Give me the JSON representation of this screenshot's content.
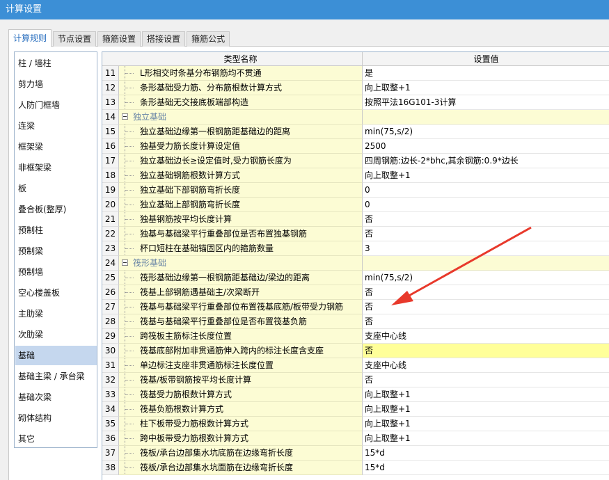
{
  "window": {
    "title": "计算设置"
  },
  "tabs": [
    {
      "label": "计算规则",
      "active": true
    },
    {
      "label": "节点设置",
      "active": false
    },
    {
      "label": "箍筋设置",
      "active": false
    },
    {
      "label": "搭接设置",
      "active": false
    },
    {
      "label": "箍筋公式",
      "active": false
    }
  ],
  "sidebar": {
    "items": [
      {
        "label": "柱 / 墙柱"
      },
      {
        "label": "剪力墙"
      },
      {
        "label": "人防门框墙"
      },
      {
        "label": "连梁"
      },
      {
        "label": "框架梁"
      },
      {
        "label": "非框架梁"
      },
      {
        "label": "板"
      },
      {
        "label": "叠合板(整厚)"
      },
      {
        "label": "预制柱"
      },
      {
        "label": "预制梁"
      },
      {
        "label": "预制墙"
      },
      {
        "label": "空心楼盖板"
      },
      {
        "label": "主肋梁"
      },
      {
        "label": "次肋梁"
      },
      {
        "label": "基础",
        "selected": true
      },
      {
        "label": "基础主梁 / 承台梁"
      },
      {
        "label": "基础次梁"
      },
      {
        "label": "砌体结构"
      },
      {
        "label": "其它"
      }
    ]
  },
  "table": {
    "headers": {
      "name": "类型名称",
      "value": "设置值"
    },
    "rows": [
      {
        "num": "11",
        "name": "L形相交时条基分布钢筋均不贯通",
        "value": "是"
      },
      {
        "num": "12",
        "name": "条形基础受力筋、分布筋根数计算方式",
        "value": "向上取整+1"
      },
      {
        "num": "13",
        "name": "条形基础无交接底板端部构造",
        "value": "按照平法16G101-3计算"
      },
      {
        "num": "14",
        "name": "独立基础",
        "value": "",
        "group": true
      },
      {
        "num": "15",
        "name": "独立基础边缘第一根钢筋距基础边的距离",
        "value": "min(75,s/2)"
      },
      {
        "num": "16",
        "name": "独基受力筋长度计算设定值",
        "value": "2500"
      },
      {
        "num": "17",
        "name": "独立基础边长≥设定值时,受力钢筋长度为",
        "value": "四周钢筋:边长-2*bhc,其余钢筋:0.9*边长"
      },
      {
        "num": "18",
        "name": "独立基础钢筋根数计算方式",
        "value": "向上取整+1"
      },
      {
        "num": "19",
        "name": "独立基础下部钢筋弯折长度",
        "value": "0"
      },
      {
        "num": "20",
        "name": "独立基础上部钢筋弯折长度",
        "value": "0"
      },
      {
        "num": "21",
        "name": "独基钢筋按平均长度计算",
        "value": "否"
      },
      {
        "num": "22",
        "name": "独基与基础梁平行重叠部位是否布置独基钢筋",
        "value": "否"
      },
      {
        "num": "23",
        "name": "杯口短柱在基础锚固区内的箍筋数量",
        "value": "3"
      },
      {
        "num": "24",
        "name": "筏形基础",
        "value": "",
        "group": true
      },
      {
        "num": "25",
        "name": "筏形基础边缘第一根钢筋距基础边/梁边的距离",
        "value": "min(75,s/2)"
      },
      {
        "num": "26",
        "name": "筏基上部钢筋遇基础主/次梁断开",
        "value": "否"
      },
      {
        "num": "27",
        "name": "筏基与基础梁平行重叠部位布置筏基底筋/板带受力钢筋",
        "value": "否"
      },
      {
        "num": "28",
        "name": "筏基与基础梁平行重叠部位是否布置筏基负筋",
        "value": "否"
      },
      {
        "num": "29",
        "name": "跨筏板主筋标注长度位置",
        "value": "支座中心线"
      },
      {
        "num": "30",
        "name": "筏基底部附加非贯通筋伸入跨内的标注长度含支座",
        "value": "否",
        "selected": true
      },
      {
        "num": "31",
        "name": "单边标注支座非贯通筋标注长度位置",
        "value": "支座中心线"
      },
      {
        "num": "32",
        "name": "筏基/板带钢筋按平均长度计算",
        "value": "否"
      },
      {
        "num": "33",
        "name": "筏基受力筋根数计算方式",
        "value": "向上取整+1"
      },
      {
        "num": "34",
        "name": "筏基负筋根数计算方式",
        "value": "向上取整+1"
      },
      {
        "num": "35",
        "name": "柱下板带受力筋根数计算方式",
        "value": "向上取整+1"
      },
      {
        "num": "36",
        "name": "跨中板带受力筋根数计算方式",
        "value": "向上取整+1"
      },
      {
        "num": "37",
        "name": "筏板/承台边部集水坑底筋在边缘弯折长度",
        "value": "15*d"
      },
      {
        "num": "38",
        "name": "筏板/承台边部集水坑面筋在边缘弯折长度",
        "value": "15*d"
      }
    ]
  },
  "annotation": {
    "color": "#e8392b"
  }
}
